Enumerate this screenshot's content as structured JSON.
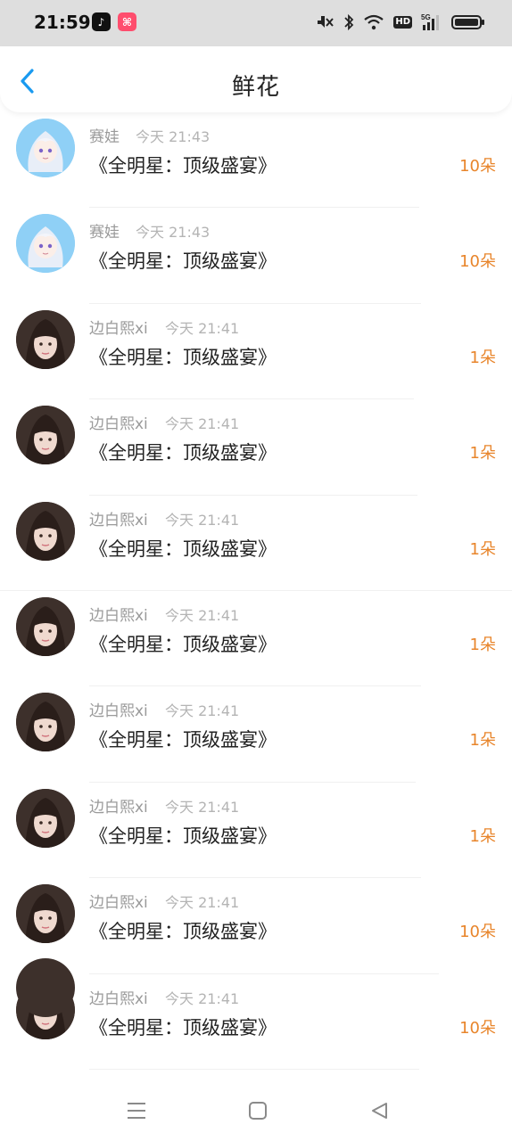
{
  "status_bar": {
    "time": "21:59",
    "app_icons": [
      "tiktok-icon",
      "xiaohongshu-icon"
    ],
    "hd_label": "HD",
    "network_label": "5G",
    "right_icons": [
      "mute-icon",
      "bluetooth-icon",
      "wifi-icon",
      "hd-icon",
      "signal-5g-icon",
      "battery-icon"
    ]
  },
  "header": {
    "title": "鲜花",
    "back_icon": "chevron-left-icon",
    "accent_color": "#1a9af0"
  },
  "items": [
    {
      "name": "赛娃",
      "time": "今天 21:43",
      "title": "《全明星：顶级盛宴》",
      "count": "10朵",
      "avatar": "anime"
    },
    {
      "name": "赛娃",
      "time": "今天 21:43",
      "title": "《全明星：顶级盛宴》",
      "count": "10朵",
      "avatar": "anime"
    },
    {
      "name": "边白熙xi",
      "time": "今天 21:41",
      "title": "《全明星：顶级盛宴》",
      "count": "1朵",
      "avatar": "photo"
    },
    {
      "name": "边白熙xi",
      "time": "今天 21:41",
      "title": "《全明星：顶级盛宴》",
      "count": "1朵",
      "avatar": "photo"
    },
    {
      "name": "边白熙xi",
      "time": "今天 21:41",
      "title": "《全明星：顶级盛宴》",
      "count": "1朵",
      "avatar": "photo"
    },
    {
      "name": "边白熙xi",
      "time": "今天 21:41",
      "title": "《全明星：顶级盛宴》",
      "count": "1朵",
      "avatar": "photo"
    },
    {
      "name": "边白熙xi",
      "time": "今天 21:41",
      "title": "《全明星：顶级盛宴》",
      "count": "1朵",
      "avatar": "photo"
    },
    {
      "name": "边白熙xi",
      "time": "今天 21:41",
      "title": "《全明星：顶级盛宴》",
      "count": "1朵",
      "avatar": "photo"
    },
    {
      "name": "边白熙xi",
      "time": "今天 21:41",
      "title": "《全明星：顶级盛宴》",
      "count": "10朵",
      "avatar": "photo"
    },
    {
      "name": "边白熙xi",
      "time": "今天 21:41",
      "title": "《全明星：顶级盛宴》",
      "count": "10朵",
      "avatar": "photo"
    }
  ],
  "count_color": "#e8852b",
  "system_nav": [
    "menu-icon",
    "home-icon",
    "back-triangle-icon"
  ]
}
